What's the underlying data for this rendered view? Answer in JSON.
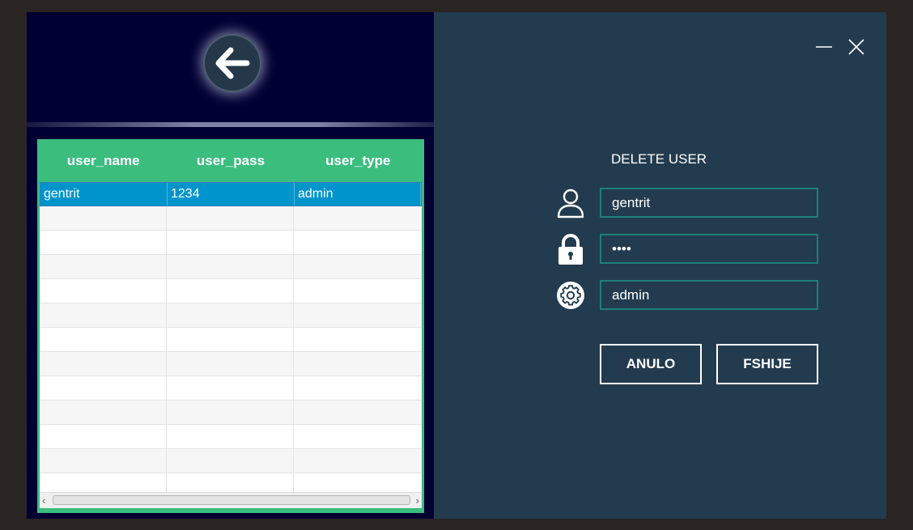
{
  "table": {
    "headers": [
      "user_name",
      "user_pass",
      "user_type"
    ],
    "rows": [
      [
        "gentrit",
        "1234",
        "admin"
      ],
      [
        "",
        "",
        ""
      ],
      [
        "",
        "",
        ""
      ],
      [
        "",
        "",
        ""
      ],
      [
        "",
        "",
        ""
      ],
      [
        "",
        "",
        ""
      ],
      [
        "",
        "",
        ""
      ],
      [
        "",
        "",
        ""
      ],
      [
        "",
        "",
        ""
      ],
      [
        "",
        "",
        ""
      ],
      [
        "",
        "",
        ""
      ],
      [
        "",
        "",
        ""
      ],
      [
        "",
        "",
        ""
      ]
    ],
    "selected_row": 0
  },
  "form": {
    "title": "DELETE USER",
    "username_value": "gentrit",
    "password_value": "1234",
    "type_value": "admin"
  },
  "buttons": {
    "cancel_label": "ANULO",
    "delete_label": "FSHIJE"
  },
  "icons": {
    "back": "arrow-left-icon",
    "user": "user-icon",
    "lock": "lock-icon",
    "settings": "gear-icon",
    "minimize": "minimize-icon",
    "close": "close-icon"
  },
  "colors": {
    "left_bg": "#000033",
    "right_bg": "#233b4e",
    "table_header": "#3bbd7e",
    "selection": "#0094cc",
    "input_border": "#1b8078"
  }
}
